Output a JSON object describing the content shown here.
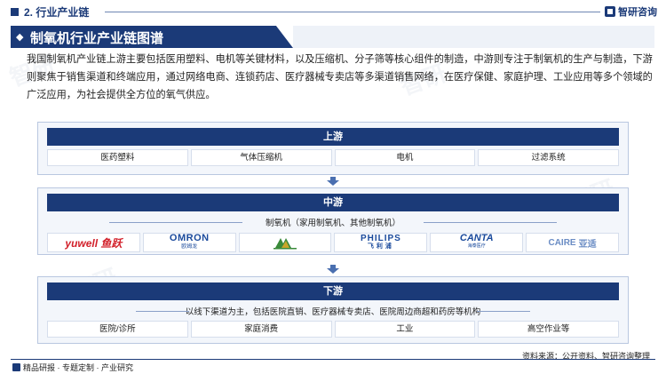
{
  "header": {
    "section_label": "2. 行业产业链",
    "brand_name": "智研咨询"
  },
  "title": "制氧机行业产业链图谱",
  "description": "我国制氧机产业链上游主要包括医用塑料、电机等关键材料，以及压缩机、分子筛等核心组件的制造，中游则专注于制氧机的生产与制造，下游则聚焦于销售渠道和终端应用，通过网络电商、连锁药店、医疗器械专卖店等多渠道销售网络，在医疗保健、家庭护理、工业应用等多个领域的广泛应用，为社会提供全方位的氧气供应。",
  "upstream": {
    "header": "上游",
    "items": [
      "医药塑料",
      "气体压缩机",
      "电机",
      "过滤系统"
    ]
  },
  "midstream": {
    "header": "中游",
    "subtitle": "制氧机（家用制氧机、其他制氧机）",
    "logos": [
      {
        "name": "yuwell",
        "text": "yuwell 鱼跃"
      },
      {
        "name": "omron",
        "text": "OMRON",
        "sub": "欧姆龙"
      },
      {
        "name": "nidek",
        "text": ""
      },
      {
        "name": "philips",
        "text": "PHILIPS",
        "sub": "飞利浦"
      },
      {
        "name": "canta",
        "text": "CANTA",
        "sub": "海泰医疗"
      },
      {
        "name": "caire",
        "text": "CAIRE",
        "sub": "亚适"
      }
    ]
  },
  "downstream": {
    "header": "下游",
    "subtitle": "以线下渠道为主，包括医院直销、医疗器械专卖店、医院周边商超和药房等机构",
    "items": [
      "医院/诊所",
      "家庭消费",
      "工业",
      "高空作业等"
    ]
  },
  "footer": {
    "left": "精品研报 · 专题定制 · 产业研究",
    "source": "资料来源：公开资料、智研咨询整理"
  },
  "colors": {
    "primary": "#1b3a78",
    "panel_bg": "#f3f6fb",
    "arrow": "#4a6fb0"
  }
}
